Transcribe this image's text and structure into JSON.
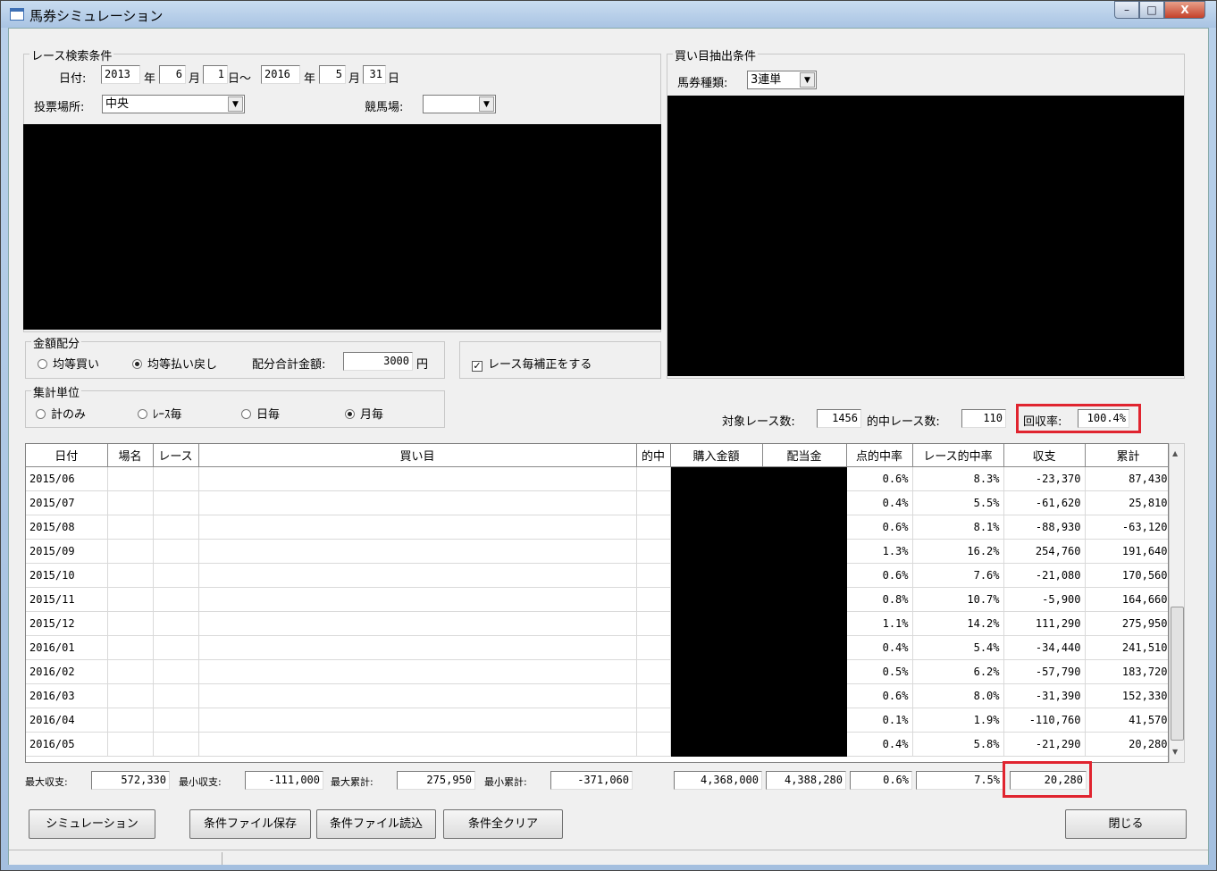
{
  "window": {
    "title": "馬券シミュレーション",
    "buttons": {
      "minimize": "–",
      "maximize": "□",
      "close": "X"
    }
  },
  "race_search": {
    "legend": "レース検索条件",
    "date_label": "日付:",
    "start_year": "2013",
    "year_label": "年",
    "start_month": "6",
    "month_label": "月",
    "start_day": "1",
    "range_sep": "日～",
    "end_year": "2016",
    "end_month": "5",
    "end_day": "31",
    "day_label": "日",
    "venue_label": "投票場所:",
    "venue_value": "中央",
    "track_label": "競馬場:",
    "track_value": ""
  },
  "bet_extract": {
    "legend": "買い目抽出条件",
    "type_label": "馬券種類:",
    "type_value": "3連単"
  },
  "amount": {
    "legend": "金額配分",
    "opt1": "均等買い",
    "opt2": "均等払い戻し",
    "total_label": "配分合計金額:",
    "total_value": "3000",
    "unit": "円"
  },
  "race_correction": "レース毎補正をする",
  "aggregation": {
    "legend": "集計単位",
    "opt1": "計のみ",
    "opt2": "ﾚｰｽ毎",
    "opt3": "日毎",
    "opt4": "月毎"
  },
  "summary": {
    "target_label": "対象レース数:",
    "target_value": "1456",
    "hit_label": "的中レース数:",
    "hit_value": "110",
    "return_label": "回収率:",
    "return_value": "100.4%"
  },
  "table": {
    "headers": [
      "日付",
      "場名",
      "レース",
      "買い目",
      "的中",
      "購入金額",
      "配当金",
      "点的中率",
      "レース的中率",
      "収支",
      "累計"
    ],
    "rows": [
      {
        "date": "2015/06",
        "point": "0.6%",
        "race": "8.3%",
        "balance": "-23,370",
        "cum": "87,430"
      },
      {
        "date": "2015/07",
        "point": "0.4%",
        "race": "5.5%",
        "balance": "-61,620",
        "cum": "25,810"
      },
      {
        "date": "2015/08",
        "point": "0.6%",
        "race": "8.1%",
        "balance": "-88,930",
        "cum": "-63,120"
      },
      {
        "date": "2015/09",
        "point": "1.3%",
        "race": "16.2%",
        "balance": "254,760",
        "cum": "191,640"
      },
      {
        "date": "2015/10",
        "point": "0.6%",
        "race": "7.6%",
        "balance": "-21,080",
        "cum": "170,560"
      },
      {
        "date": "2015/11",
        "point": "0.8%",
        "race": "10.7%",
        "balance": "-5,900",
        "cum": "164,660"
      },
      {
        "date": "2015/12",
        "point": "1.1%",
        "race": "14.2%",
        "balance": "111,290",
        "cum": "275,950"
      },
      {
        "date": "2016/01",
        "point": "0.4%",
        "race": "5.4%",
        "balance": "-34,440",
        "cum": "241,510"
      },
      {
        "date": "2016/02",
        "point": "0.5%",
        "race": "6.2%",
        "balance": "-57,790",
        "cum": "183,720"
      },
      {
        "date": "2016/03",
        "point": "0.6%",
        "race": "8.0%",
        "balance": "-31,390",
        "cum": "152,330"
      },
      {
        "date": "2016/04",
        "point": "0.1%",
        "race": "1.9%",
        "balance": "-110,760",
        "cum": "41,570"
      },
      {
        "date": "2016/05",
        "point": "0.4%",
        "race": "5.8%",
        "balance": "-21,290",
        "cum": "20,280"
      }
    ]
  },
  "stats": {
    "max_balance_label": "最大収支:",
    "max_balance": "572,330",
    "min_balance_label": "最小収支:",
    "min_balance": "-111,000",
    "max_cum_label": "最大累計:",
    "max_cum": "275,950",
    "min_cum_label": "最小累計:",
    "min_cum": "-371,060",
    "total_purchase": "4,368,000",
    "total_payout": "4,388,280",
    "total_point_rate": "0.6%",
    "total_race_rate": "7.5%",
    "total_balance": "20,280"
  },
  "buttons": {
    "simulate": "シミュレーション",
    "save": "条件ファイル保存",
    "load": "条件ファイル読込",
    "clear": "条件全クリア",
    "close": "閉じる"
  },
  "colors": {
    "highlight": "#e0242f"
  }
}
